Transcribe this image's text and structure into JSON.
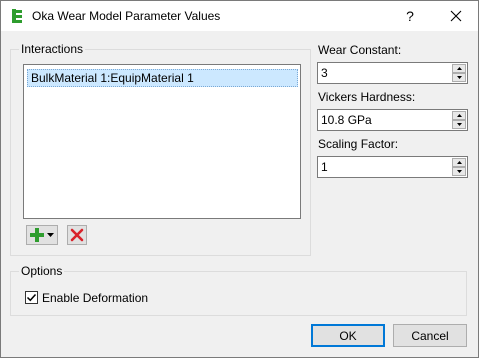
{
  "window": {
    "title": "Oka Wear Model Parameter Values",
    "help_label": "?",
    "close_label": "✕",
    "app_icon": "ansys-tree-icon"
  },
  "interactions": {
    "label": "Interactions",
    "items": [
      "BulkMaterial 1:EquipMaterial 1"
    ],
    "selected_index": 0,
    "add_icon": "green-plus-dropdown-icon",
    "remove_icon": "red-x-icon"
  },
  "parameters": {
    "wear_constant": {
      "label": "Wear Constant:",
      "value": "3"
    },
    "vickers_hardness": {
      "label": "Vickers Hardness:",
      "value": "10.8 GPa"
    },
    "scaling_factor": {
      "label": "Scaling Factor:",
      "value": "1"
    }
  },
  "options": {
    "label": "Options",
    "enable_deformation": {
      "label": "Enable Deformation",
      "checked": true
    }
  },
  "buttons": {
    "ok": "OK",
    "cancel": "Cancel"
  },
  "colors": {
    "selection": "#cce8ff",
    "accent": "#0078d7",
    "add_green": "#2e9d2e",
    "remove_red": "#d9222a"
  }
}
